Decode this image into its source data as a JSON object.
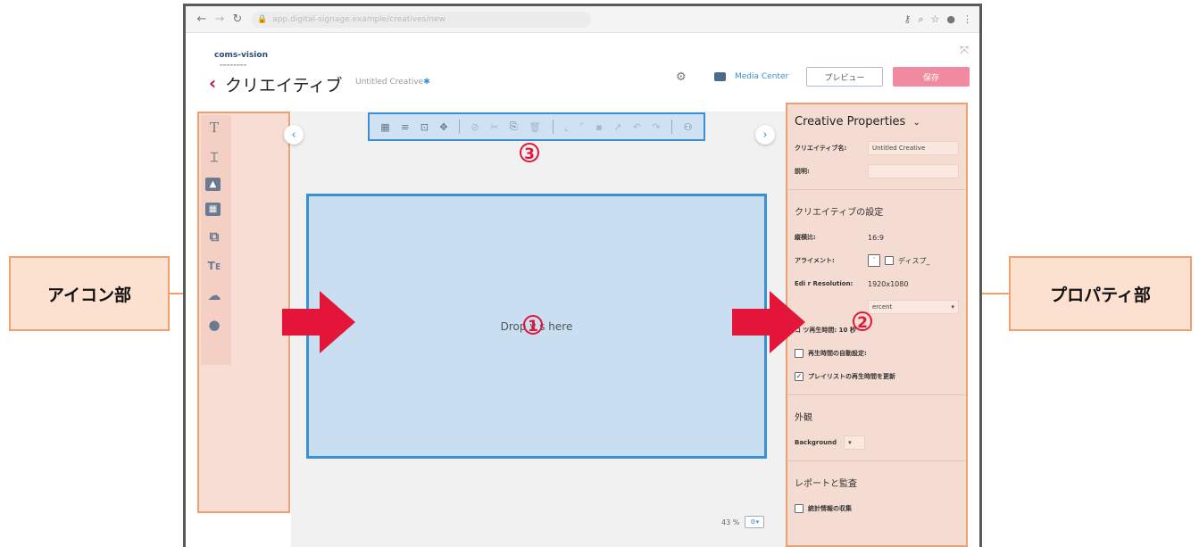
{
  "callouts": {
    "left_label": "アイコン部",
    "right_label": "プロパティ部"
  },
  "browser": {
    "url": "app.digital-signage.example/creatives/new",
    "icons": [
      "key-icon",
      "zoom-icon",
      "star-icon",
      "account-icon",
      "menu-icon"
    ]
  },
  "header": {
    "logo": "coms-vision",
    "page_title": "クリエイティブ",
    "creative_name": "Untitled Creative",
    "creative_name_mark": "✱",
    "media_center": "Media Center",
    "preview": "プレビュー",
    "save": "保存",
    "expand_glyph": "⤧"
  },
  "icon_panel": {
    "tools": [
      "text",
      "text-box",
      "image",
      "video",
      "slideshow",
      "rich-text",
      "weather",
      "clock"
    ],
    "glyphs": [
      "T",
      "⌶",
      "▲",
      "▦",
      "⧉",
      "Tᴇ",
      "☁",
      "●"
    ]
  },
  "toolbar": {
    "glyphs": [
      "▦",
      "≡",
      "⊡",
      "✥",
      "⊘",
      "✂",
      "⎘",
      "🗑",
      "⌞",
      "⌜",
      "▪",
      "↗",
      "↶",
      "↷",
      "⚇"
    ]
  },
  "canvas": {
    "drop_text": "Drop v   s here",
    "zoom": "43 %",
    "zoom_select": "⚙▾"
  },
  "properties": {
    "title": "Creative Properties",
    "name_label": "クリエイティブ名:",
    "name_value": "Untitled Creative",
    "desc_label": "説明:",
    "settings_heading": "クリエイティブの設定",
    "aspect_label": "縦横比:",
    "aspect_value": "16:9",
    "align_label": "アライメント:",
    "align_value": "ディスプ_",
    "resolution_label": "Edi  r Resolution:",
    "resolution_value": "1920x1080",
    "unit_value": "ercent",
    "duration_text": "コ   ツ再生時間: 10 秒",
    "auto_duration": "再生時間の自動設定:",
    "update_playlist": "プレイリストの再生時間を更新",
    "appearance_heading": "外観",
    "background_label": "Background",
    "report_heading": "レポートと監査",
    "collect_stats": "統計情報の収集"
  },
  "badges": {
    "one": "1",
    "two": "2",
    "three": "3"
  },
  "colors": {
    "accent": "#3a8fd5",
    "brand_red": "#c0163a",
    "save": "#f08aa0",
    "highlight_orange": "#f0a070"
  }
}
